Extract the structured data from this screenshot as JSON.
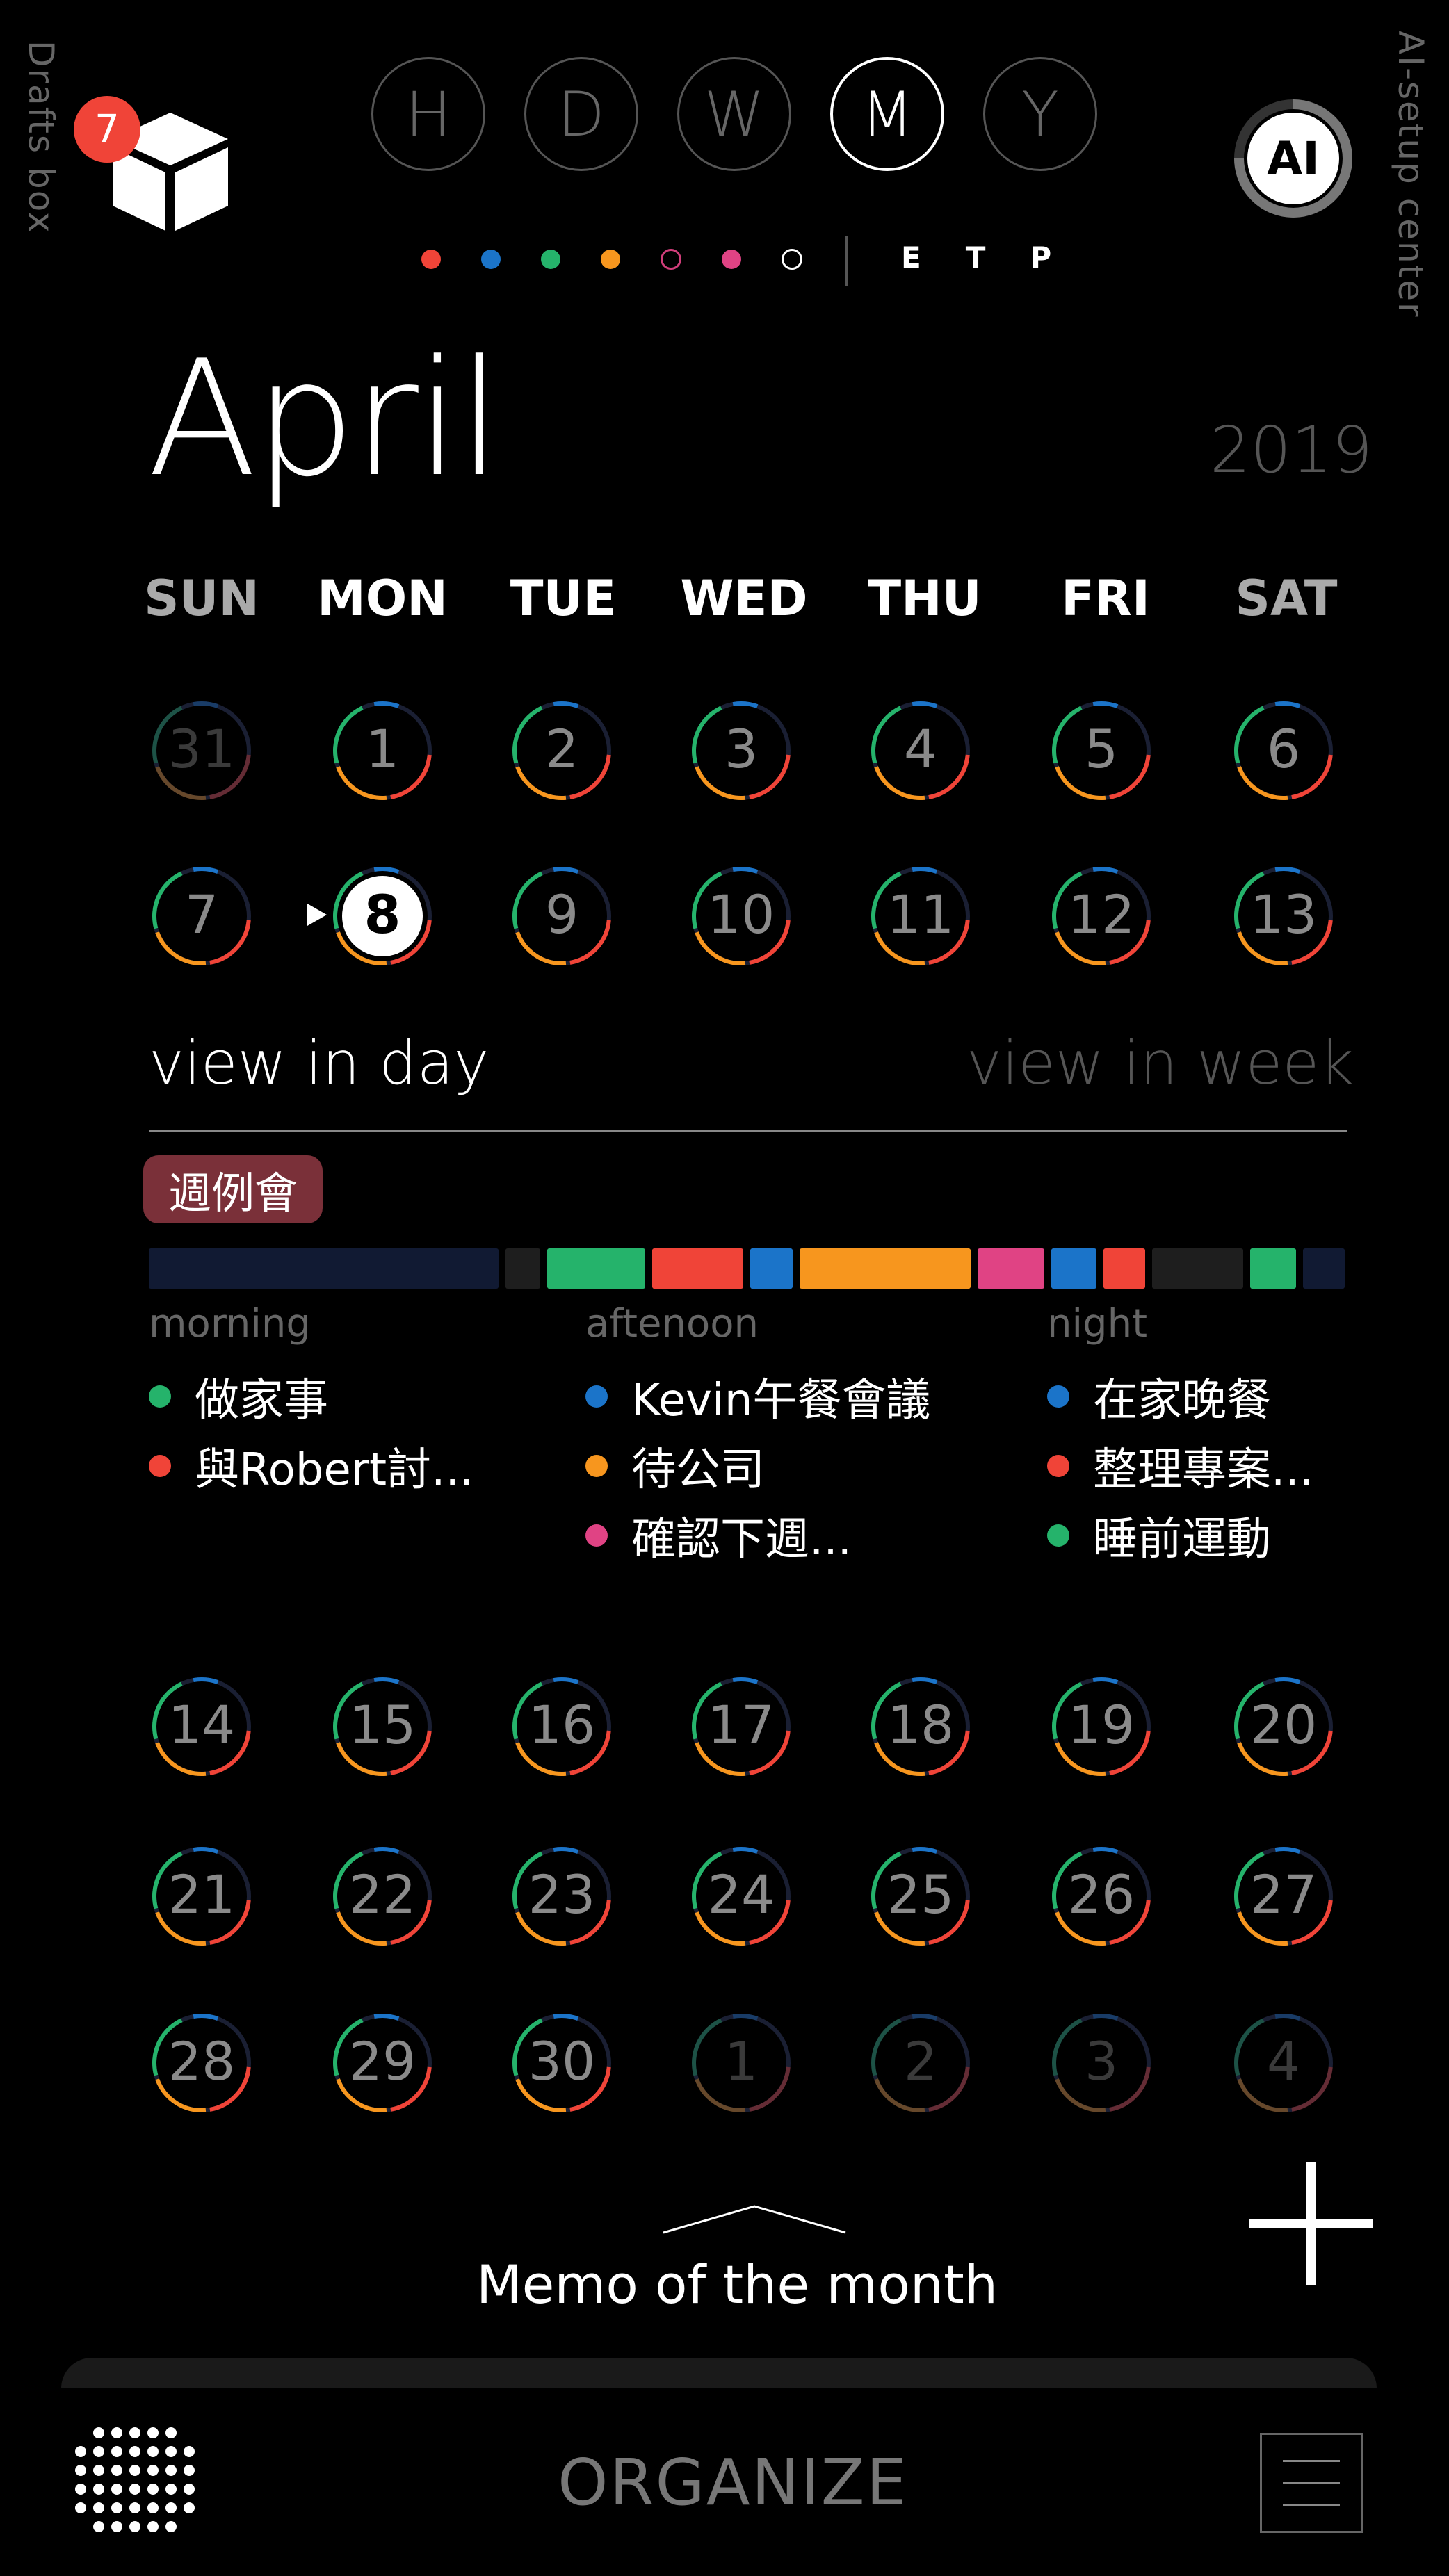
{
  "drafts": {
    "label": "Drafts box",
    "badge": "7"
  },
  "ai": {
    "label": "AI",
    "side_label": "AI-setup center"
  },
  "modes": [
    {
      "label": "H",
      "active": false
    },
    {
      "label": "D",
      "active": false
    },
    {
      "label": "W",
      "active": false
    },
    {
      "label": "M",
      "active": true
    },
    {
      "label": "Y",
      "active": false
    }
  ],
  "filter_dots": [
    {
      "color": "#f04438",
      "style": "solid"
    },
    {
      "color": "#1b74c9",
      "style": "solid"
    },
    {
      "color": "#25b36b",
      "style": "solid"
    },
    {
      "color": "#f7961e",
      "style": "solid"
    },
    {
      "color": "#d03e7a",
      "style": "ring"
    },
    {
      "color": "#e04384",
      "style": "solid"
    },
    {
      "color": "#ffffff",
      "style": "ring"
    }
  ],
  "etp": [
    "E",
    "T",
    "P"
  ],
  "calendar": {
    "month": "April",
    "year": "2019",
    "weekdays": [
      "SUN",
      "MON",
      "TUE",
      "WED",
      "THU",
      "FRI",
      "SAT"
    ],
    "weekday_colors": [
      "#aaaaaa",
      "#ffffff",
      "#ffffff",
      "#ffffff",
      "#ffffff",
      "#ffffff",
      "#aaaaaa"
    ],
    "week1": [
      {
        "num": "31",
        "dim": true
      },
      {
        "num": "1"
      },
      {
        "num": "2"
      },
      {
        "num": "3"
      },
      {
        "num": "4"
      },
      {
        "num": "5"
      },
      {
        "num": "6"
      }
    ],
    "week2": [
      {
        "num": "7"
      },
      {
        "num": "8",
        "selected": true
      },
      {
        "num": "9"
      },
      {
        "num": "10"
      },
      {
        "num": "11"
      },
      {
        "num": "12"
      },
      {
        "num": "13"
      }
    ],
    "week3": [
      {
        "num": "14"
      },
      {
        "num": "15"
      },
      {
        "num": "16"
      },
      {
        "num": "17"
      },
      {
        "num": "18"
      },
      {
        "num": "19"
      },
      {
        "num": "20"
      }
    ],
    "week4": [
      {
        "num": "21"
      },
      {
        "num": "22"
      },
      {
        "num": "23"
      },
      {
        "num": "24"
      },
      {
        "num": "25"
      },
      {
        "num": "26"
      },
      {
        "num": "27"
      }
    ],
    "week5": [
      {
        "num": "28"
      },
      {
        "num": "29"
      },
      {
        "num": "30"
      },
      {
        "num": "1",
        "dim": true
      },
      {
        "num": "2",
        "dim": true
      },
      {
        "num": "3",
        "dim": true
      },
      {
        "num": "4",
        "dim": true
      }
    ]
  },
  "views": {
    "day": "view in day",
    "week": "view in week"
  },
  "tag": "週例會",
  "timeline": [
    {
      "color": "#111a33",
      "weight": 10
    },
    {
      "color": "#1e1e1e",
      "weight": 1
    },
    {
      "color": "#25b36b",
      "weight": 2.8
    },
    {
      "color": "#f04438",
      "weight": 2.6
    },
    {
      "color": "#1b74c9",
      "weight": 1.2
    },
    {
      "color": "#f7961e",
      "weight": 4.9
    },
    {
      "color": "#e04384",
      "weight": 1.9
    },
    {
      "color": "#1b74c9",
      "weight": 1.3
    },
    {
      "color": "#f04438",
      "weight": 1.2
    },
    {
      "color": "#1e1e1e",
      "weight": 2.6
    },
    {
      "color": "#25b36b",
      "weight": 1.3
    },
    {
      "color": "#111a33",
      "weight": 1.2
    }
  ],
  "periods": [
    {
      "title": "morning",
      "events": [
        {
          "color": "#25b36b",
          "text": "做家事"
        },
        {
          "color": "#f04438",
          "text": "與Robert討..."
        }
      ]
    },
    {
      "title": "aftenoon",
      "events": [
        {
          "color": "#1b74c9",
          "text": "Kevin午餐會議"
        },
        {
          "color": "#f7961e",
          "text": "待公司"
        },
        {
          "color": "#e04384",
          "text": "確認下週..."
        }
      ]
    },
    {
      "title": "night",
      "events": [
        {
          "color": "#1b74c9",
          "text": "在家晚餐"
        },
        {
          "color": "#f04438",
          "text": "整理專案..."
        },
        {
          "color": "#25b36b",
          "text": "睡前運動"
        }
      ]
    }
  ],
  "memo": "Memo of the month",
  "bottom": {
    "organize": "ORGANIZE"
  },
  "ring_colors": [
    "#1b74c9",
    "#f04438",
    "#f7961e",
    "#25b36b"
  ],
  "accent": "#f04438"
}
